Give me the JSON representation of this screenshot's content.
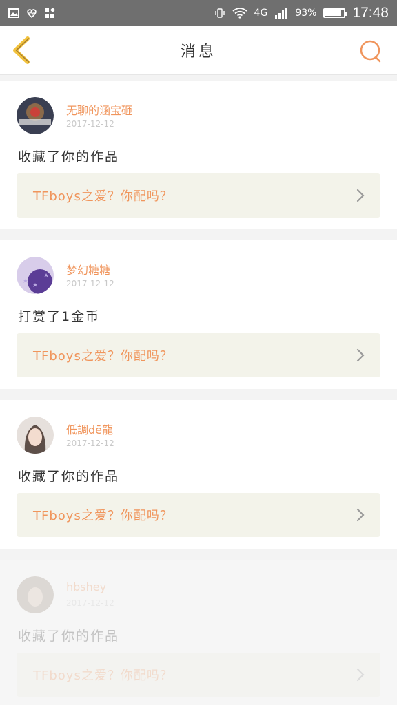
{
  "status_bar": {
    "network": "4G",
    "battery": "93%",
    "time": "17:48",
    "battery_level": 0.93
  },
  "header": {
    "title": "消息",
    "back_icon": "chevron-left-icon",
    "search_icon": "search-icon"
  },
  "messages": [
    {
      "username": "无聊的涵宝砸",
      "date": "2017-12-12",
      "action": "收藏了你的作品",
      "work_title": "TFboys之爱？你配吗？"
    },
    {
      "username": "梦幻糖糖",
      "date": "2017-12-12",
      "action": "打赏了1金币",
      "work_title": "TFboys之爱？你配吗？"
    },
    {
      "username": "低調dē龍",
      "date": "2017-12-12",
      "action": "收藏了你的作品",
      "work_title": "TFboys之爱？你配吗？"
    },
    {
      "username": "hbshey",
      "date": "2017-12-12",
      "action": "收藏了你的作品",
      "work_title": "TFboys之爱？你配吗？"
    }
  ],
  "colors": {
    "accent": "#f0955c",
    "back_icon": "#f2c23c",
    "search_icon": "#f0955c",
    "status_bar": "#6f6f6f"
  }
}
